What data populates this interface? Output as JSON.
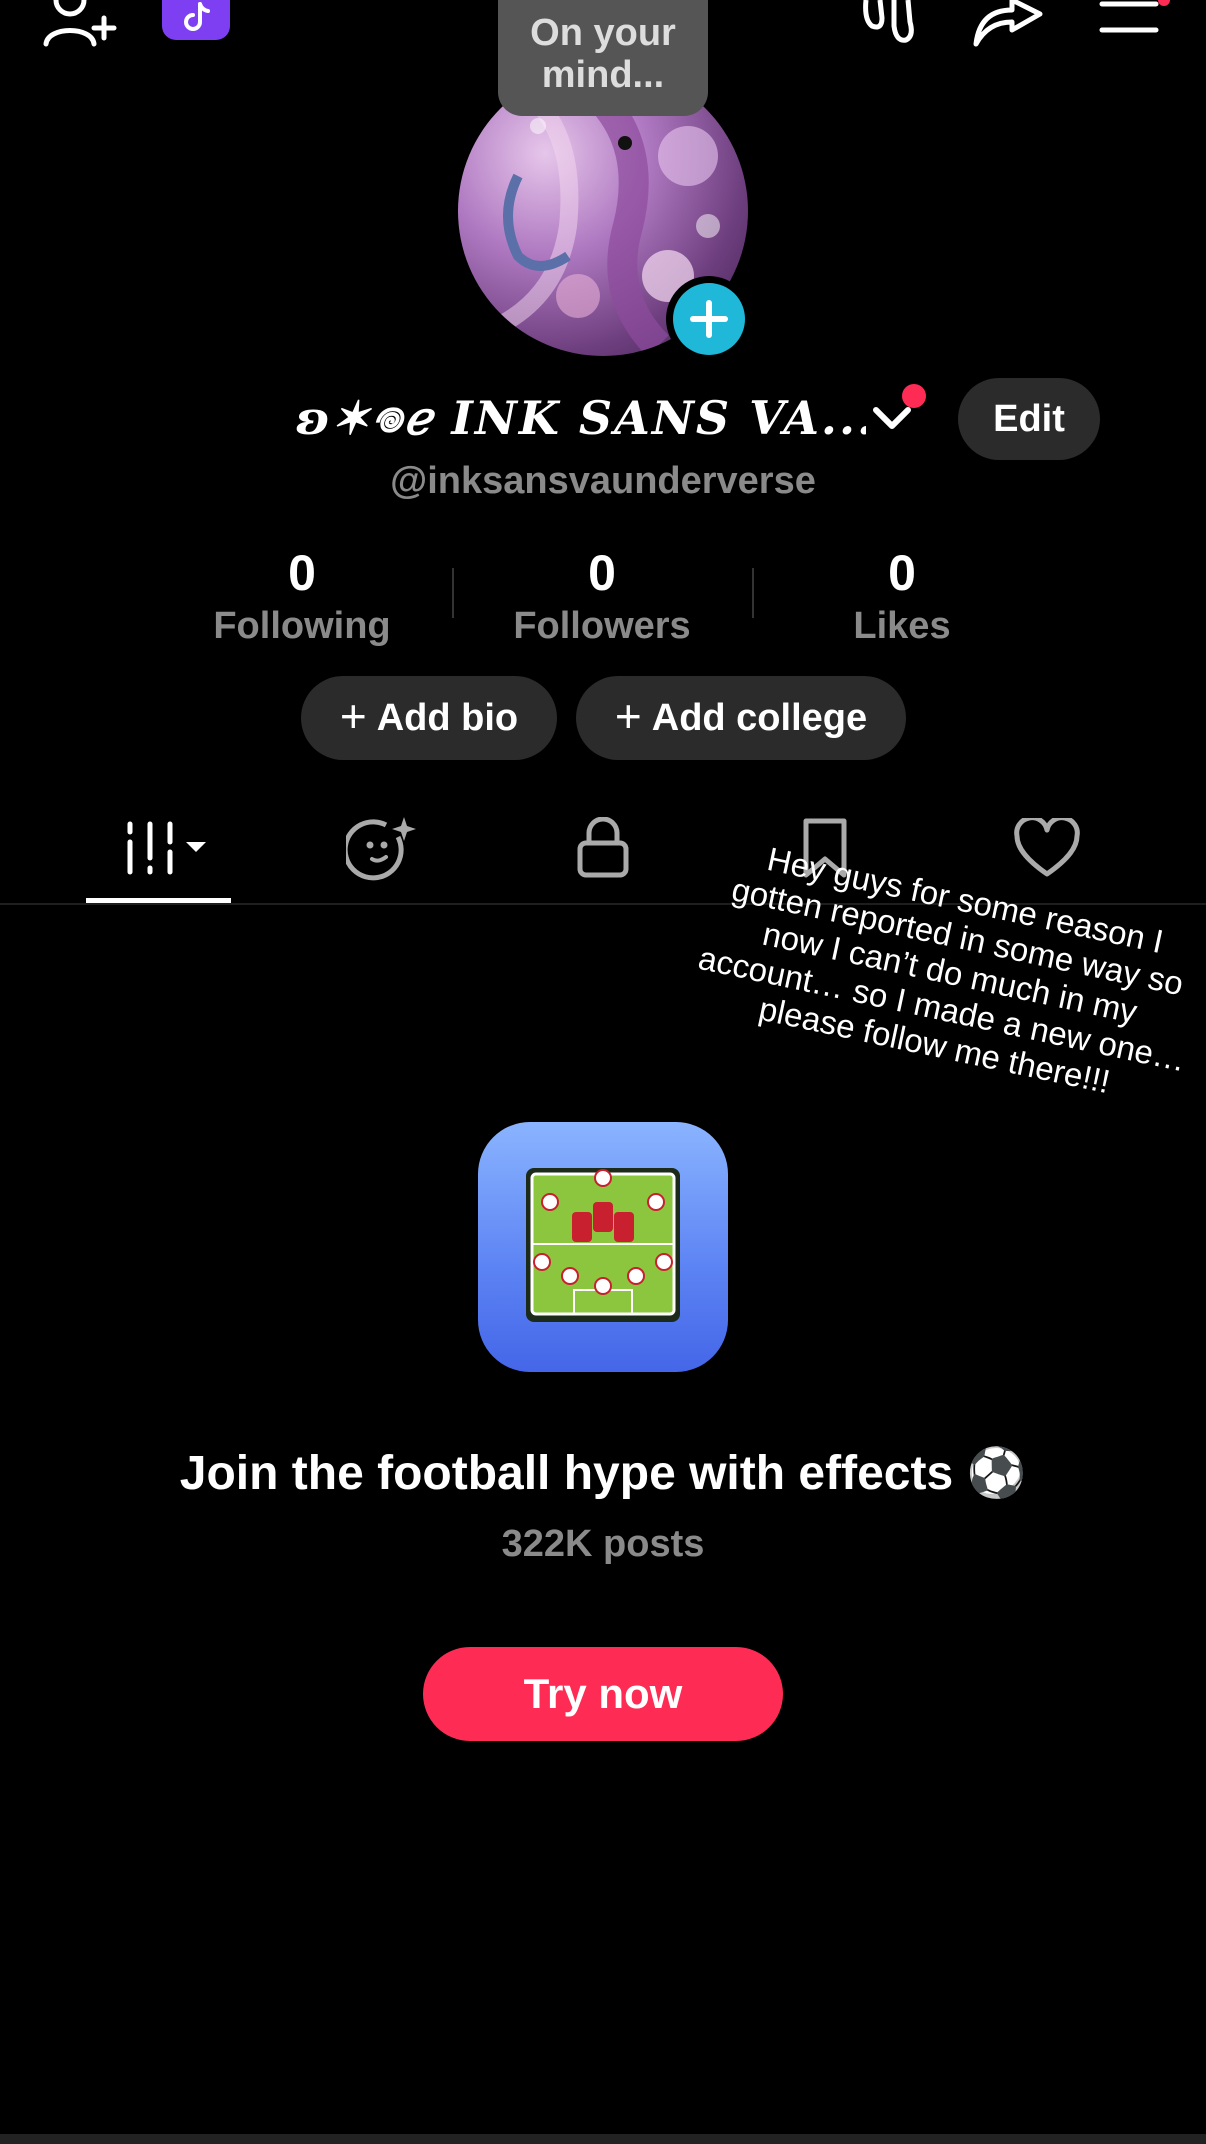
{
  "top_bar": {
    "icons": [
      "add-friend-icon",
      "tiktok-badge-icon",
      "footprints-icon",
      "share-icon",
      "menu-icon"
    ]
  },
  "bubble": {
    "line1": "On your",
    "line2": "mind..."
  },
  "profile": {
    "display_name": "ʚ✶𖦹ℯ INK SANS VA...",
    "username": "@inksansvaunderverse",
    "edit_label": "Edit"
  },
  "stats": [
    {
      "value": "0",
      "label": "Following"
    },
    {
      "value": "0",
      "label": "Followers"
    },
    {
      "value": "0",
      "label": "Likes"
    }
  ],
  "pills": {
    "add_bio": "Add bio",
    "add_college": "Add college"
  },
  "tabs": [
    "videos-grid-icon",
    "ai-self-icon",
    "lock-icon",
    "bookmark-icon",
    "heart-icon"
  ],
  "note": {
    "text": "Hey guys for some reason I gotten reported in some way so now I can’t do much in my account… so I made a new one… please follow me there!!!"
  },
  "promo": {
    "title": "Join the football hype with effects ⚽",
    "posts": "322K posts",
    "button": "Try now"
  },
  "colors": {
    "background": "#000000",
    "accent_red": "#fe2c55",
    "avatar_plus": "#1fb8d9",
    "pill_bg": "#2b2b2b",
    "muted_text": "#8a8a8a"
  }
}
